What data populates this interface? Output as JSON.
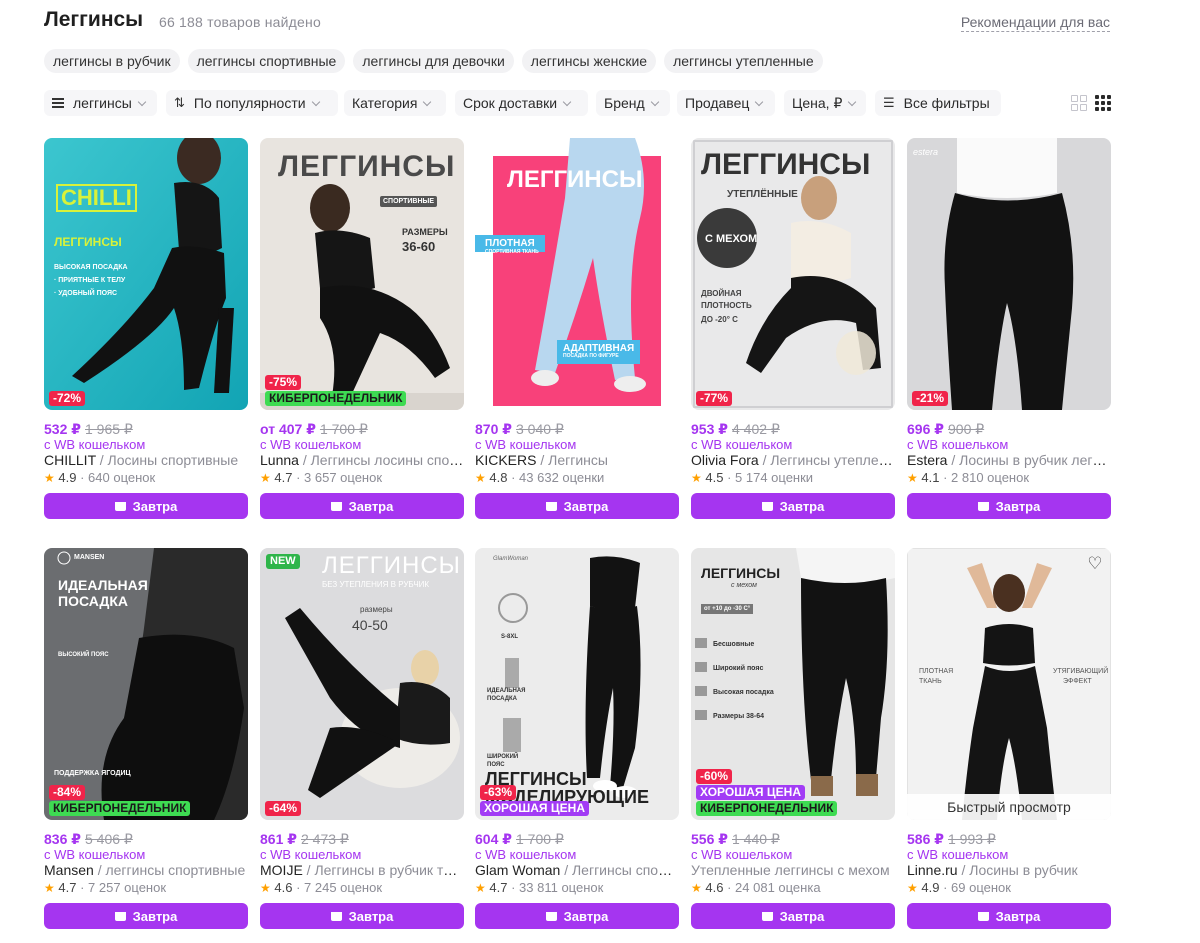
{
  "header": {
    "title": "Леггинсы",
    "count": "66 188 товаров найдено",
    "recommendations": "Рекомендации для вас"
  },
  "chips": [
    "леггинсы в рубчик",
    "леггинсы спортивные",
    "леггинсы для девочки",
    "леггинсы женские",
    "леггинсы утепленные"
  ],
  "filters": {
    "category_sel": "леггинсы",
    "sort": "По популярности",
    "category": "Категория",
    "delivery": "Срок доставки",
    "brand": "Бренд",
    "seller": "Продавец",
    "price": "Цена, ₽",
    "all": "Все фильтры"
  },
  "buy_label": "Завтра",
  "wallet_label": "с WB кошельком",
  "quick_view": "Быстрый просмотр",
  "products": [
    {
      "price": "532 ₽",
      "old": "1 965 ₽",
      "brand": "CHILLIT",
      "cat": " / Лосины спортивные",
      "rating": "4.9",
      "reviews": "640 оценок",
      "badges": [
        "-72%"
      ],
      "img_texts": [
        "ЛЕГГИНСЫ",
        "ВЫСОКАЯ ПОСАДКА",
        "· ПРИЯТНЫЕ К ТЕЛУ",
        "· УДОБНЫЙ ПОЯС"
      ],
      "logo": "CHILLI"
    },
    {
      "price": "от 407 ₽",
      "old": "1 700 ₽",
      "brand": "Lunna",
      "cat": " / Леггинсы лосины спортивные",
      "rating": "4.7",
      "reviews": "3 657 оценок",
      "badges": [
        "-75%",
        "КИБЕРПОНЕДЕЛЬНИК"
      ],
      "img_texts": [
        "ЛЕГГИНСЫ",
        "СПОРТИВНЫЕ",
        "РАЗМЕРЫ",
        "36-60"
      ]
    },
    {
      "price": "870 ₽",
      "old": "3 040 ₽",
      "brand": "KICKERS",
      "cat": " / Леггинсы",
      "rating": "4.8",
      "reviews": "43 632 оценки",
      "badges": [],
      "img_texts": [
        "ЛЕГГИНСЫ",
        "ПЛОТНАЯ",
        "СПОРТИВНАЯ ТКАНЬ",
        "АДАПТИВНАЯ",
        "ПОСАДКА ПО ФИГУРЕ"
      ]
    },
    {
      "price": "953 ₽",
      "old": "4 402 ₽",
      "brand": "Olivia Fora",
      "cat": " / Леггинсы утепленные",
      "rating": "4.5",
      "reviews": "5 174 оценки",
      "badges": [
        "-77%"
      ],
      "img_texts": [
        "ЛЕГГИНСЫ",
        "УТЕПЛЁННЫЕ",
        "С МЕХОМ",
        "ДВОЙНАЯ",
        "ПЛОТНОСТЬ",
        "ДО -20° С"
      ]
    },
    {
      "price": "696 ₽",
      "old": "900 ₽",
      "brand": "Estera",
      "cat": " / Лосины в рубчик леггинсы",
      "rating": "4.1",
      "reviews": "2 810 оценок",
      "badges": [
        "-21%"
      ],
      "img_texts": [
        "estera"
      ]
    },
    {
      "price": "836 ₽",
      "old": "5 406 ₽",
      "brand": "Mansen",
      "cat": " / леггинсы спортивные",
      "rating": "4.7",
      "reviews": "7 257 оценок",
      "badges": [
        "-84%",
        "КИБЕРПОНЕДЕЛЬНИК"
      ],
      "img_texts": [
        "MANSEN",
        "ИДЕАЛЬНАЯ",
        "ПОСАДКА",
        "ВЫСОКИЙ ПОЯС",
        "ПОДДЕРЖКА ЯГОДИЦ"
      ]
    },
    {
      "price": "861 ₽",
      "old": "2 473 ₽",
      "brand": "MOIJE",
      "cat": " / Леггинсы в рубчик теплые",
      "rating": "4.6",
      "reviews": "7 245 оценок",
      "badges": [
        "-64%"
      ],
      "img_texts": [
        "NEW",
        "ЛЕГГИНСЫ",
        "БЕЗ УТЕПЛЕНИЯ В РУБЧИК",
        "размеры",
        "40-50"
      ]
    },
    {
      "price": "604 ₽",
      "old": "1 700 ₽",
      "brand": "Glam Woman",
      "cat": " / Леггинсы спортивные",
      "rating": "4.7",
      "reviews": "33 811 оценок",
      "badges": [
        "-63%",
        "ХОРОШАЯ ЦЕНА"
      ],
      "img_texts": [
        "S-8XL",
        "ИДЕАЛЬНАЯ",
        "ПОСАДКА",
        "ШИРОКИЙ",
        "ПОЯС",
        "ЛЕГГИНСЫ",
        "МОДЕЛИРУЮЩИЕ"
      ]
    },
    {
      "price": "556 ₽",
      "old": "1 440 ₽",
      "brand": "",
      "cat": "Утепленные леггинсы с мехом",
      "rating": "4.6",
      "reviews": "24 081 оценка",
      "badges": [
        "-60%",
        "ХОРОШАЯ ЦЕНА",
        "КИБЕРПОНЕДЕЛЬНИК"
      ],
      "img_texts": [
        "ЛЕГГИНСЫ",
        "с мехом",
        "от +10 до -30 С°",
        "Бесшовные",
        "Широкий пояс",
        "Высокая посадка",
        "Размеры 38-64"
      ]
    },
    {
      "price": "586 ₽",
      "old": "1 993 ₽",
      "brand": "Linne.ru",
      "cat": " / Лосины в рубчик",
      "rating": "4.9",
      "reviews": "69 оценок",
      "badges": [],
      "img_texts": [
        "ПЛОТНАЯ",
        "ТКАНЬ",
        "УТЯГИВАЮЩИЙ",
        "ЭФФЕКТ"
      ]
    }
  ],
  "colors": {
    "accent": "#a535f0",
    "discount": "#f0244a",
    "cyber": "#3edb52",
    "good_price": "#a23cf5",
    "star": "#ffa000"
  }
}
